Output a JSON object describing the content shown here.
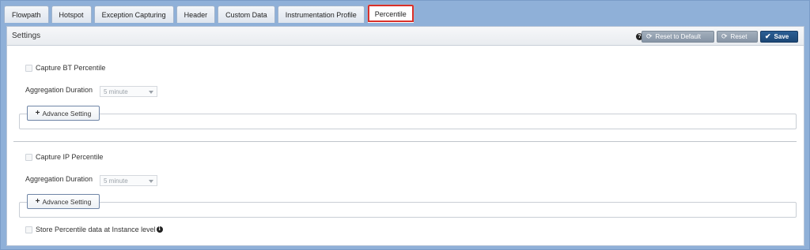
{
  "tabs": [
    {
      "label": "Flowpath"
    },
    {
      "label": "Hotspot"
    },
    {
      "label": "Exception Capturing"
    },
    {
      "label": "Header"
    },
    {
      "label": "Custom Data"
    },
    {
      "label": "Instrumentation Profile"
    },
    {
      "label": "Percentile",
      "active": true
    }
  ],
  "panel": {
    "title": "Settings",
    "buttons": {
      "reset_default": "Reset to Default",
      "reset": "Reset",
      "save": "Save"
    }
  },
  "bt_section": {
    "capture_label": "Capture BT Percentile",
    "capture_checked": false,
    "aggregation_label": "Aggregation Duration",
    "aggregation_value": "5 minute",
    "advance_label": "Advance Setting"
  },
  "ip_section": {
    "capture_label": "Capture IP Percentile",
    "capture_checked": false,
    "aggregation_label": "Aggregation Duration",
    "aggregation_value": "5 minute",
    "advance_label": "Advance Setting"
  },
  "instance_level": {
    "label": "Store Percentile data at Instance level",
    "checked": false
  },
  "colors": {
    "frame": "#8fb0d8",
    "save_button": "#1c4776",
    "active_tab_outline": "#d9302a"
  }
}
